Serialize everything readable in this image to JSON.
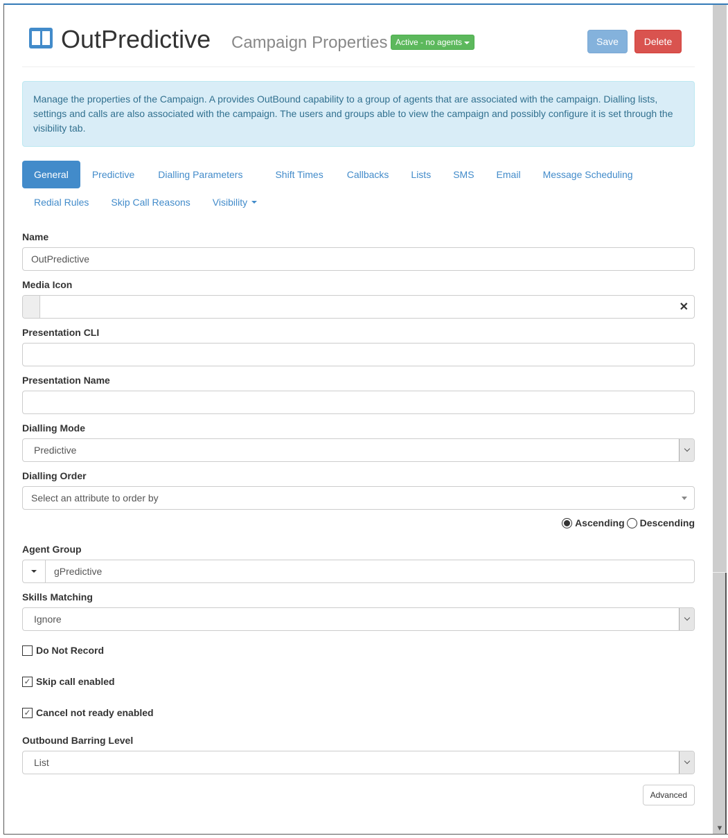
{
  "header": {
    "app_title": "OutPredictive",
    "page_subtitle": "Campaign Properties",
    "status_badge": "Active - no agents",
    "save_label": "Save",
    "delete_label": "Delete",
    "colors": {
      "primary": "#428bca",
      "success": "#5cb85c",
      "danger": "#d9534f"
    }
  },
  "info": {
    "text": "Manage the properties of the Campaign. A provides OutBound capability to a group of agents that are associated with the campaign. Dialling lists, settings and calls are also associated with the campaign. The users and groups able to view the campaign and possibly configure it is set through the visibility tab."
  },
  "tabs": [
    {
      "label": "General",
      "active": true
    },
    {
      "label": "Predictive"
    },
    {
      "label": "Dialling Parameters"
    },
    {
      "label": "Shift Times"
    },
    {
      "label": "Callbacks"
    },
    {
      "label": "Lists"
    },
    {
      "label": "SMS"
    },
    {
      "label": "Email"
    },
    {
      "label": "Message Scheduling"
    },
    {
      "label": "Redial Rules"
    },
    {
      "label": "Skip Call Reasons"
    },
    {
      "label": "Visibility"
    }
  ],
  "form": {
    "name": {
      "label": "Name",
      "value": "OutPredictive"
    },
    "media_icon": {
      "label": "Media Icon",
      "value": ""
    },
    "presentation_cli": {
      "label": "Presentation CLI",
      "value": ""
    },
    "presentation_name": {
      "label": "Presentation Name",
      "value": ""
    },
    "dialling_mode": {
      "label": "Dialling Mode",
      "value": "Predictive"
    },
    "dialling_order": {
      "label": "Dialling Order",
      "placeholder": "Select an attribute to order by"
    },
    "order_direction": {
      "ascending": "Ascending",
      "descending": "Descending",
      "selected": "Ascending"
    },
    "agent_group": {
      "label": "Agent Group",
      "value": "gPredictive"
    },
    "skills_matching": {
      "label": "Skills Matching",
      "value": "Ignore"
    },
    "do_not_record": {
      "label": "Do Not Record",
      "checked": false
    },
    "skip_call_enabled": {
      "label": "Skip call enabled",
      "checked": true
    },
    "cancel_not_ready_enabled": {
      "label": "Cancel not ready enabled",
      "checked": true
    },
    "outbound_barring_level": {
      "label": "Outbound Barring Level",
      "value": "List"
    },
    "advanced_label": "Advanced"
  }
}
